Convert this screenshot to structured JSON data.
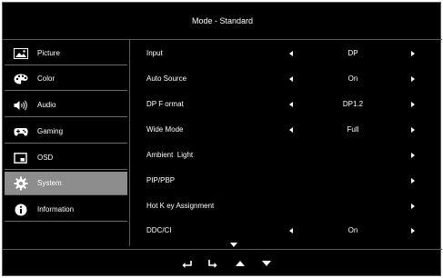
{
  "header": {
    "title": "Mode - Standard"
  },
  "sidebar": {
    "items": [
      {
        "label": "Picture",
        "icon": "picture-icon"
      },
      {
        "label": "Color",
        "icon": "palette-icon"
      },
      {
        "label": "Audio",
        "icon": "speaker-icon"
      },
      {
        "label": "Gaming",
        "icon": "gamepad-icon"
      },
      {
        "label": "OSD",
        "icon": "osd-window-icon"
      },
      {
        "label": "System",
        "icon": "gear-icon",
        "active": true
      },
      {
        "label": "Information",
        "icon": "info-icon"
      }
    ]
  },
  "settings": {
    "rows": [
      {
        "label": "Input",
        "value": "DP",
        "left_arrow": true,
        "right_arrow": true
      },
      {
        "label": "Auto Source",
        "value": "On",
        "left_arrow": true,
        "right_arrow": true
      },
      {
        "label": "DP F ormat",
        "value": "DP1.2",
        "left_arrow": true,
        "right_arrow": true
      },
      {
        "label": "Wide Mode",
        "value": "Full",
        "left_arrow": true,
        "right_arrow": true
      },
      {
        "label": "Ambient  Light",
        "value": "",
        "left_arrow": false,
        "right_arrow": true
      },
      {
        "label": "PIP/PBP",
        "value": "",
        "left_arrow": false,
        "right_arrow": true
      },
      {
        "label": "Hot K ey Assignment",
        "value": "",
        "left_arrow": false,
        "right_arrow": true
      },
      {
        "label": "DDC/CI",
        "value": "On",
        "left_arrow": true,
        "right_arrow": true
      }
    ]
  },
  "footer": {
    "buttons": [
      "back-icon",
      "enter-icon",
      "up-icon",
      "down-icon"
    ]
  },
  "colors": {
    "background": "#000000",
    "text": "#ffffff",
    "active": "#8c8c8c",
    "border": "#5a5a5a"
  }
}
